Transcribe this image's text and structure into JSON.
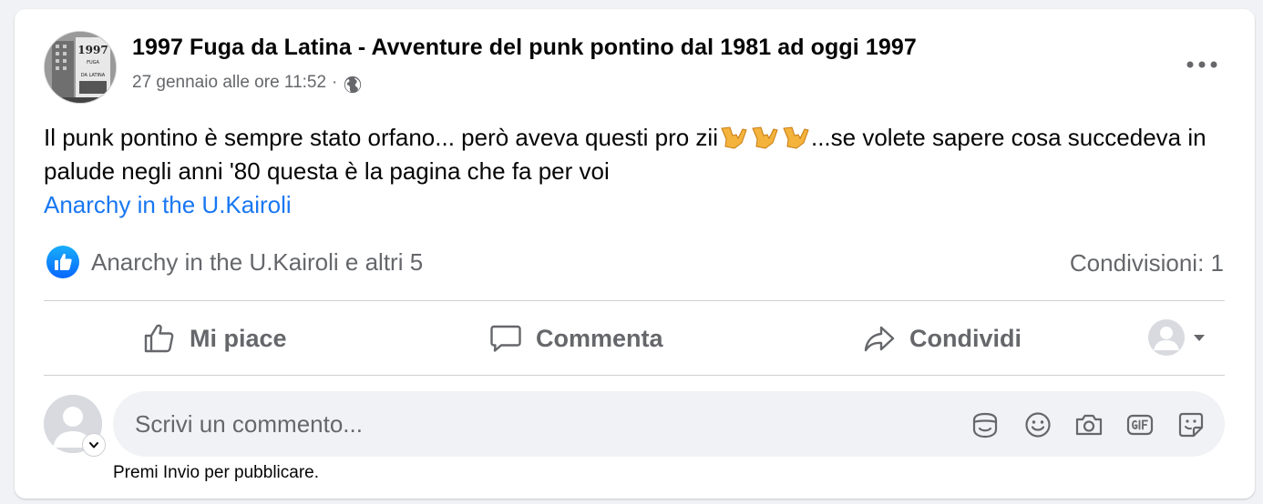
{
  "post": {
    "page_name": "1997 Fuga da Latina - Avventure del punk pontino dal 1981 ad oggi 1997",
    "timestamp": "27 gennaio alle ore 11:52",
    "separator": "·",
    "text_part1": "Il punk pontino è sempre stato orfano... però aveva questi pro zii",
    "text_part2": "...se volete sapere cosa succedeva in palude negli anni '80 questa è la pagina che fa per voi",
    "emoji": "love-you-gesture",
    "link_text": "Anarchy in the U.Kairoli",
    "avatar_text": {
      "year": "1997",
      "line1": "FUGA",
      "line2": "DA LATINA"
    }
  },
  "reactions": {
    "summary": "Anarchy in the U.Kairoli e altri 5",
    "shares": "Condivisioni: 1"
  },
  "actions": {
    "like": "Mi piace",
    "comment": "Commenta",
    "share": "Condividi"
  },
  "composer": {
    "placeholder": "Scrivi un commento...",
    "hint": "Premi Invio per pubblicare.",
    "tools": [
      "avatar-sticker-icon",
      "emoji-icon",
      "camera-icon",
      "gif-icon",
      "sticker-icon"
    ]
  },
  "colors": {
    "accent": "#1877f2",
    "secondary_text": "#65676b",
    "divider": "#ced0d4"
  }
}
